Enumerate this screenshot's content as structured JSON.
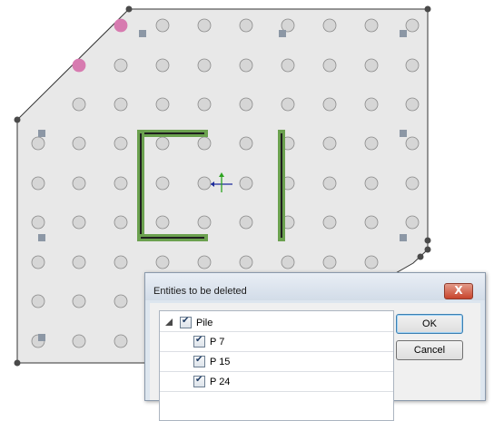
{
  "canvas": {
    "background": "#ffffff",
    "boundary_fill": "#e8e8e8",
    "pile_color": "#d6d6d6",
    "highlight_color": "#d77bb0",
    "beam_color": "#6ba14f"
  },
  "dialog": {
    "title": "Entities to be deleted",
    "close_label": "X",
    "tree": {
      "root_label": "Pile",
      "items": [
        "P 7",
        "P 15",
        "P 24"
      ]
    },
    "ok_label": "OK",
    "cancel_label": "Cancel"
  }
}
